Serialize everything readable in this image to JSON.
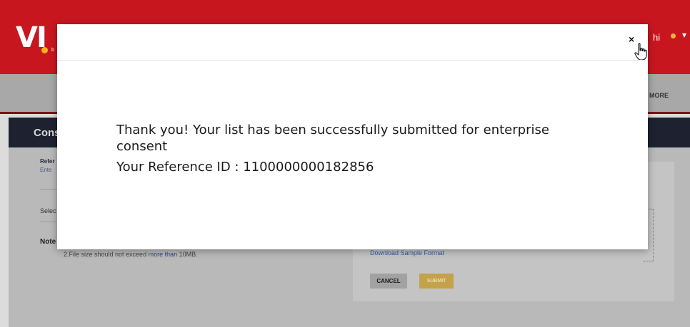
{
  "header": {
    "logo_text": "VI",
    "logo_sub": "b",
    "user_name": "hi",
    "user_caret": "▾"
  },
  "nav": {
    "more_label": "MORE"
  },
  "section": {
    "title": "Cons"
  },
  "form": {
    "ref_label": "Refer",
    "ref_input": "Ente",
    "select_label": "Selec",
    "note_label": "Note",
    "note_prefix": "2.File size should not exceed ",
    "note_highlight": "more than",
    "note_suffix": " 10MB."
  },
  "upload": {
    "download_link": "Download Sample Format",
    "cancel_label": "CANCEL",
    "submit_label": "SUBMIT"
  },
  "modal": {
    "close_label": "×",
    "message": "Thank you! Your list has been successfully submitted for enterprise consent",
    "reference_text": "Your Reference ID : 1100000000182856"
  },
  "colors": {
    "brand_red": "#c8161f",
    "section_header": "#1e2130",
    "submit_gold": "#c4a24a",
    "link_blue": "#2d5aa8"
  },
  "icons": {
    "close": "close-icon",
    "cursor": "hand-cursor-icon",
    "user": "user-icon"
  }
}
